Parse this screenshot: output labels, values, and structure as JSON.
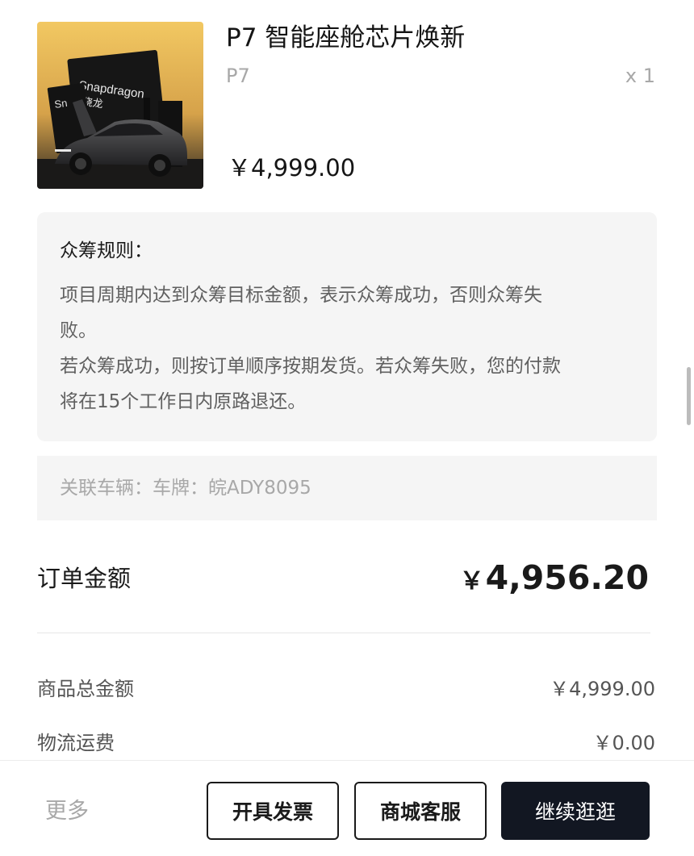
{
  "product": {
    "title": "P7 智能座舱芯片焕新",
    "variant": "P7",
    "quantity": "x 1",
    "price": "￥4,999.00",
    "image_text": {
      "brand": "Snapdragon",
      "brand_cn": "骁龙",
      "brand_partial": "Sn"
    }
  },
  "rules": {
    "title": "众筹规则：",
    "paragraphs": [
      "项目周期内达到众筹目标金额，表示众筹成功，否则众筹失",
      "败。",
      "若众筹成功，则按订单顺序按期发货。若众筹失败，您的付款",
      "将在15个工作日内原路退还。"
    ]
  },
  "vehicle": {
    "text": "关联车辆：车牌：皖ADY8095"
  },
  "order": {
    "label": "订单金额",
    "currency": "￥",
    "total": "4,956.20"
  },
  "summary": {
    "items": [
      {
        "label": "商品总金额",
        "value": "￥4,999.00"
      },
      {
        "label": "物流运费",
        "value": "￥0.00"
      }
    ]
  },
  "bottom_bar": {
    "more_label": "更多",
    "invoice_label": "开具发票",
    "service_label": "商城客服",
    "continue_label": "继续逛逛"
  },
  "colors": {
    "primary_button": "#121722",
    "image_background": "#e8b84f",
    "muted_text": "#a8a8a8"
  }
}
